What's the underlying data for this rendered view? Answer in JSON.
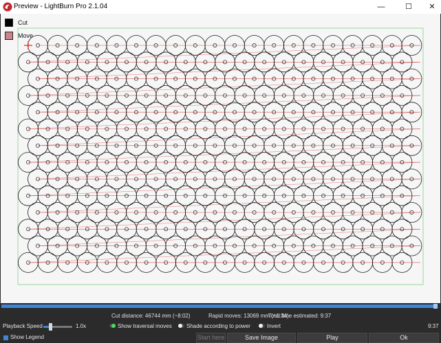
{
  "window": {
    "title": "Preview - LightBurn Pro 2.1.04",
    "minimize_glyph": "—",
    "maximize_glyph": "☐",
    "close_glyph": "✕"
  },
  "legend": {
    "items": [
      {
        "label": "Cut",
        "color": "#000000"
      },
      {
        "label": "Move",
        "color": "#c9868a"
      }
    ]
  },
  "colors": {
    "cut_stroke": "#1a1a1a",
    "move_stroke": "#d9534f",
    "bounds_stroke": "#7fd18a",
    "start_marker": "#e02020",
    "accent": "#3f86d6"
  },
  "preview": {
    "circle_columns": 21,
    "circle_rows": 14,
    "row_order": [
      "shifted-right",
      "shifted-left"
    ]
  },
  "progress": {
    "fraction": 0.995
  },
  "stats": {
    "cut_distance": "Cut distance: 46744 mm (~8:02)",
    "rapid_moves": "Rapid moves: 13069 mm (~1:34)",
    "total_time": "Total time estimated: 9:37",
    "elapsed": "9:37"
  },
  "controls": {
    "playback_speed_label": "Playback Speed",
    "playback_speed_value": "1.0x",
    "playback_speed_fraction": 0.2,
    "show_traversal_label": "Show traversal moves",
    "show_traversal_on": true,
    "shade_power_label": "Shade according to power",
    "shade_power_on": false,
    "invert_label": "Invert",
    "invert_on": false,
    "show_legend_label": "Show Legend",
    "show_legend_checked": true
  },
  "buttons": {
    "start_here": "Start here",
    "save_image": "Save Image",
    "play": "Play",
    "ok": "Ok"
  }
}
